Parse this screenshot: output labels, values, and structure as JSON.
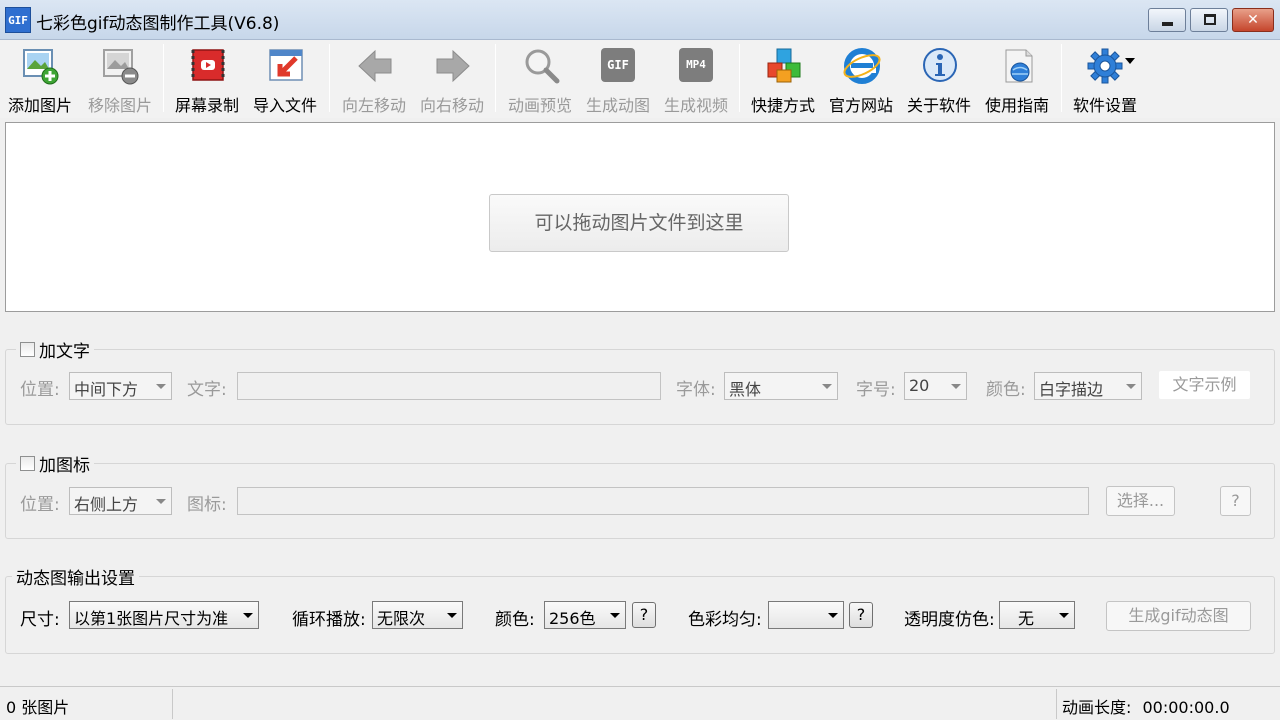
{
  "window": {
    "app_icon_text": "GIF",
    "title": "七彩色gif动态图制作工具(V6.8)",
    "controls": {
      "minimize": "",
      "maximize": "",
      "close": "✕"
    }
  },
  "toolbar": {
    "add_image": "添加图片",
    "remove_image": "移除图片",
    "screen_record": "屏幕录制",
    "import_file": "导入文件",
    "move_left": "向左移动",
    "move_right": "向右移动",
    "preview": "动画预览",
    "make_gif": "生成动图",
    "make_video": "生成视频",
    "shortcut": "快捷方式",
    "website": "官方网站",
    "about": "关于软件",
    "guide": "使用指南",
    "settings": "软件设置",
    "gif_icon_text": "GIF",
    "mp4_icon_text": "MP4"
  },
  "drop_area": {
    "hint": "可以拖动图片文件到这里"
  },
  "text_group": {
    "title": "加文字",
    "checked": false,
    "position_label": "位置:",
    "position_value": "中间下方",
    "text_label": "文字:",
    "text_value": "",
    "font_label": "字体:",
    "font_value": "黑体",
    "size_label": "字号:",
    "size_value": "20",
    "color_label": "颜色:",
    "color_value": "白字描边",
    "sample_button": "文字示例"
  },
  "icon_group": {
    "title": "加图标",
    "checked": false,
    "position_label": "位置:",
    "position_value": "右侧上方",
    "icon_label": "图标:",
    "icon_value": "",
    "choose_button": "选择...",
    "help_button": "?"
  },
  "output_group": {
    "title": "动态图输出设置",
    "size_label": "尺寸:",
    "size_value": "以第1张图片尺寸为准",
    "loop_label": "循环播放:",
    "loop_value": "无限次",
    "color_label": "颜色:",
    "color_value": "256色",
    "color_help": "?",
    "balance_label": "色彩均匀:",
    "balance_value": "",
    "balance_help": "?",
    "dither_label": "透明度仿色:",
    "dither_value": "无",
    "generate_button": "生成gif动态图"
  },
  "status": {
    "image_count": "0 张图片",
    "duration_label": "动画长度:",
    "duration_value": "00:00:00.0"
  },
  "colors": {
    "title_bar": "#c7d7ea",
    "close_button": "#c5452c",
    "disabled_text": "#9a9a9a",
    "icon_blue": "#2f6fd0"
  }
}
